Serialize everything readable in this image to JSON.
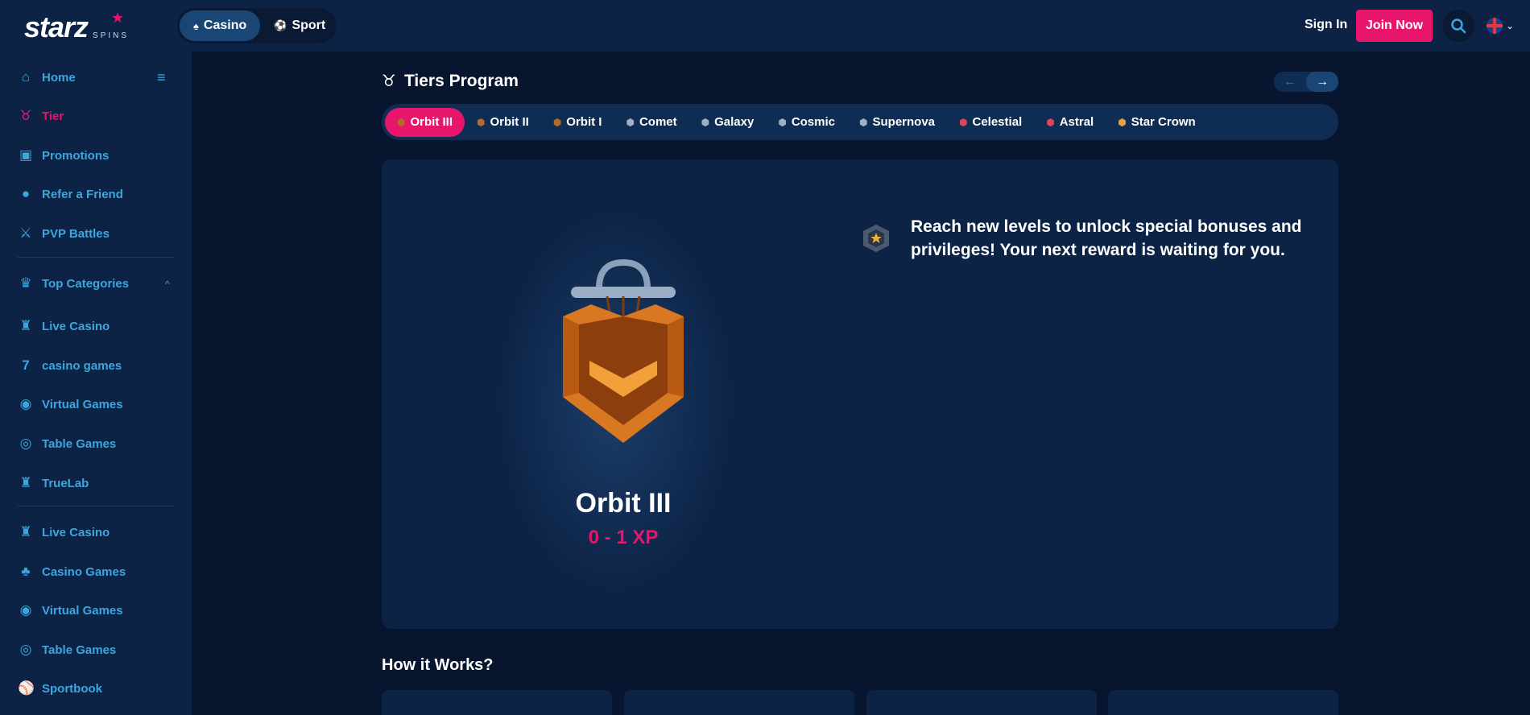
{
  "header": {
    "logo_text": "starz",
    "logo_sub": "SPINS",
    "product_tabs": [
      {
        "label": "Casino",
        "active": true
      },
      {
        "label": "Sport",
        "active": false
      }
    ],
    "sign_in": "Sign In",
    "join_now": "Join Now"
  },
  "sidebar": {
    "items": [
      {
        "label": "Home",
        "icon": "home-icon"
      },
      {
        "label": "Tier",
        "icon": "tier-icon",
        "active": true
      },
      {
        "label": "Promotions",
        "icon": "gift-icon"
      },
      {
        "label": "Refer a Friend",
        "icon": "users-icon"
      },
      {
        "label": "PVP Battles",
        "icon": "swords-icon"
      }
    ],
    "top_categories_label": "Top Categories",
    "categories": [
      {
        "label": "Live Casino",
        "icon": "live-casino-icon"
      },
      {
        "label": "casino games",
        "icon": "seven-icon"
      },
      {
        "label": "Virtual Games",
        "icon": "gamepad-icon"
      },
      {
        "label": "Table Games",
        "icon": "table-icon"
      },
      {
        "label": "TrueLab",
        "icon": "truelab-icon"
      }
    ],
    "more": [
      {
        "label": "Live Casino",
        "icon": "live-casino-icon"
      },
      {
        "label": "Casino Games",
        "icon": "cherry-icon"
      },
      {
        "label": "Virtual Games",
        "icon": "gamepad-icon"
      },
      {
        "label": "Table Games",
        "icon": "table-icon"
      },
      {
        "label": "Sportbook",
        "icon": "ball-icon"
      }
    ]
  },
  "main": {
    "title": "Tiers Program",
    "tabs": [
      {
        "label": "Orbit III",
        "active": true
      },
      {
        "label": "Orbit II"
      },
      {
        "label": "Orbit I"
      },
      {
        "label": "Comet"
      },
      {
        "label": "Galaxy"
      },
      {
        "label": "Cosmic"
      },
      {
        "label": "Supernova"
      },
      {
        "label": "Celestial"
      },
      {
        "label": "Astral"
      },
      {
        "label": "Star Crown"
      }
    ],
    "tier_name": "Orbit III",
    "tier_xp": "0 - 1 XP",
    "reward_text": "Reach new levels to unlock special bonuses and privileges! Your next reward is waiting for you.",
    "how_title": "How it Works?"
  },
  "colors": {
    "accent": "#e8156d",
    "sidebar_link": "#3da6dc",
    "bg": "#07152e",
    "panel": "#0c2346"
  }
}
